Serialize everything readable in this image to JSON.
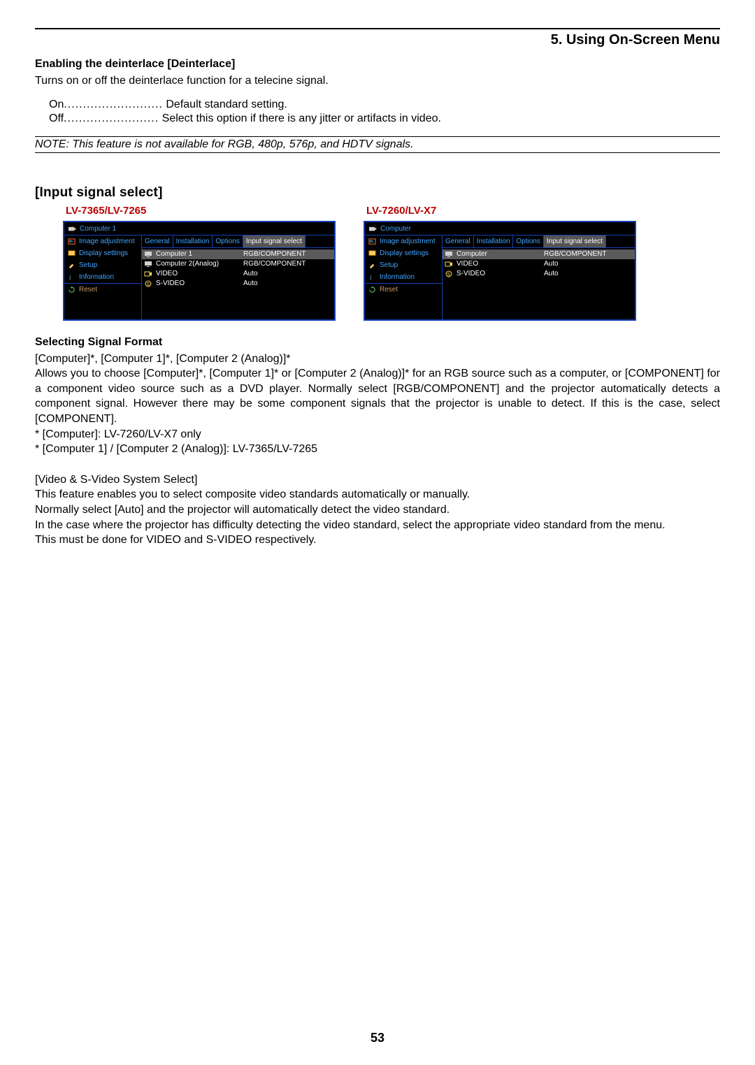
{
  "chapter": "5. Using On-Screen Menu",
  "h1": "Enabling the deinterlace [Deinterlace]",
  "deinterlace_desc": "Turns on or off the deinterlace function for a telecine signal.",
  "opts": {
    "on_label": "On",
    "on_dots": "..........................",
    "on_desc": "Default standard setting.",
    "off_label": "Off",
    "off_dots": ".........................",
    "off_desc": "Select this option if there is any jitter or artifacts in video."
  },
  "note": "NOTE: This feature is not available for RGB, 480p, 576p, and HDTV signals.",
  "section": "[Input signal select]",
  "models": {
    "left": "LV-7365/LV-7265",
    "right": "LV-7260/LV-X7"
  },
  "osd_left": {
    "title": "Computer 1",
    "nav": [
      "Image adjustment",
      "Display settings",
      "Setup",
      "Information",
      "Reset"
    ],
    "tabs": [
      "General",
      "Installation",
      "Options",
      "Input signal select"
    ],
    "rows": [
      {
        "label": "Computer 1",
        "value": "RGB/COMPONENT",
        "hi": true
      },
      {
        "label": "Computer 2(Analog)",
        "value": "RGB/COMPONENT"
      },
      {
        "label": "VIDEO",
        "value": "Auto"
      },
      {
        "label": "S-VIDEO",
        "value": "Auto"
      }
    ]
  },
  "osd_right": {
    "title": "Computer",
    "nav": [
      "Image adjustment",
      "Display settings",
      "Setup",
      "Information",
      "Reset"
    ],
    "tabs": [
      "General",
      "Installation",
      "Options",
      "Input signal select"
    ],
    "rows": [
      {
        "label": "Computer",
        "value": "RGB/COMPONENT",
        "hi": true
      },
      {
        "label": "VIDEO",
        "value": "Auto"
      },
      {
        "label": "S-VIDEO",
        "value": "Auto"
      }
    ]
  },
  "h2": "Selecting Signal Format",
  "sf_line1": "[Computer]*, [Computer 1]*, [Computer 2 (Analog)]*",
  "sf_para": "Allows you to choose [Computer]*, [Computer 1]* or [Computer 2 (Analog)]* for an RGB source such as a computer, or [COMPONENT] for a component video source such as a DVD player. Normally select [RGB/COMPONENT] and the projector automatically detects a component signal. However there may be some component signals that the projector is unable to detect. If this is the case, select [COMPONENT].",
  "sf_foot1": "*  [Computer]: LV-7260/LV-X7 only",
  "sf_foot2": "*  [Computer 1] / [Computer 2 (Analog)]: LV-7365/LV-7265",
  "vs_head": "[Video & S-Video System Select]",
  "vs_l1": "This feature enables you to select composite video standards automatically or manually.",
  "vs_l2": "Normally select [Auto] and the projector will automatically detect the video standard.",
  "vs_l3": "In the case where the projector has difficulty detecting the video standard, select the appropriate video standard from the menu.",
  "vs_l4": "This must be done for VIDEO and S-VIDEO respectively.",
  "pagenum": "53"
}
